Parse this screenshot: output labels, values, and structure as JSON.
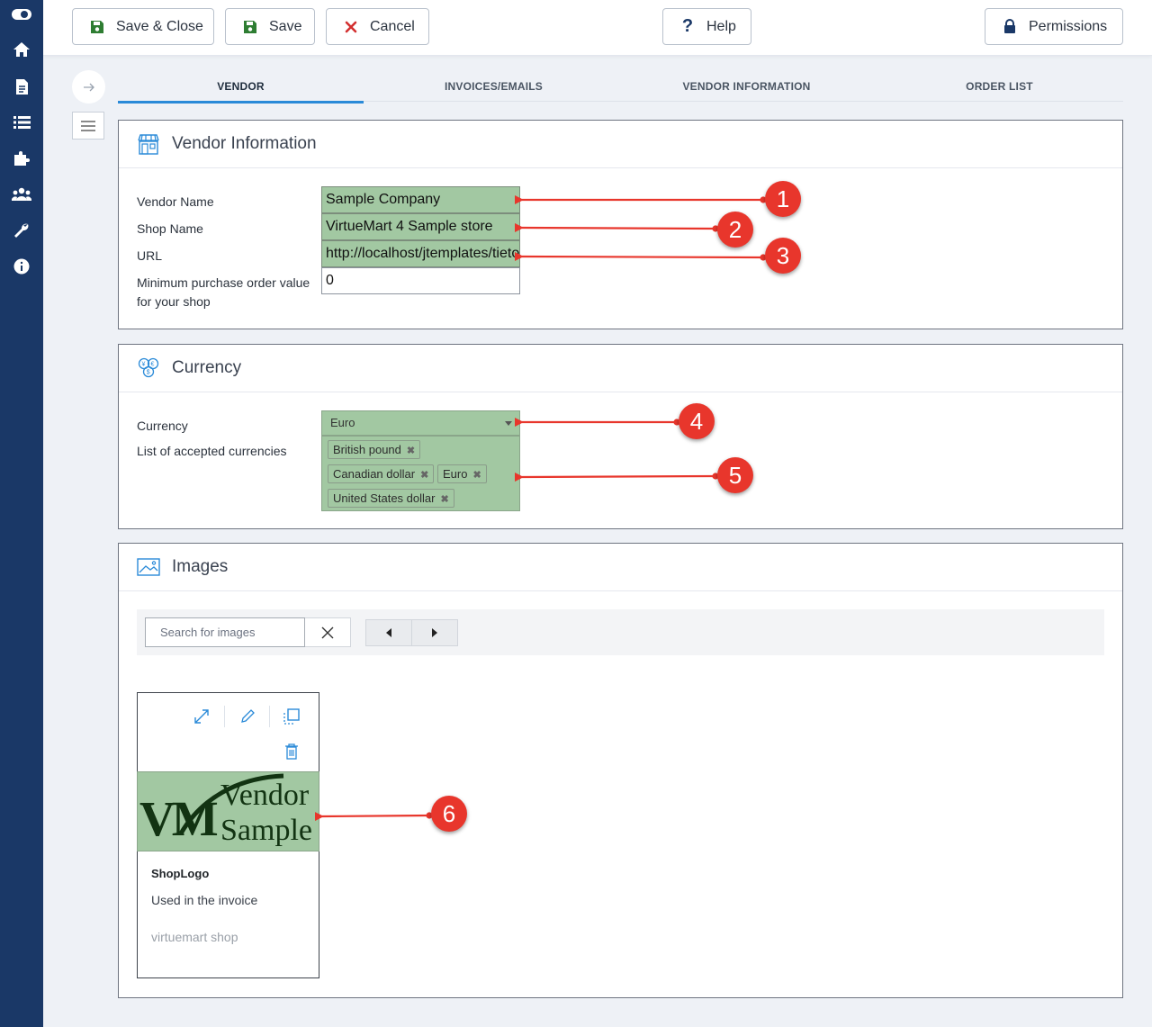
{
  "toolbar": {
    "save_close": "Save & Close",
    "save": "Save",
    "cancel": "Cancel",
    "help": "Help",
    "permissions": "Permissions"
  },
  "tabs": [
    {
      "label": "VENDOR",
      "active": true
    },
    {
      "label": "INVOICES/EMAILS",
      "active": false
    },
    {
      "label": "VENDOR INFORMATION",
      "active": false
    },
    {
      "label": "ORDER LIST",
      "active": false
    }
  ],
  "vendor_panel": {
    "title": "Vendor Information",
    "vendor_name_label": "Vendor Name",
    "vendor_name_value": "Sample Company",
    "shop_name_label": "Shop Name",
    "shop_name_value": "VirtueMart 4 Sample store",
    "url_label": "URL",
    "url_value": "http://localhost/jtemplates/tieto",
    "min_order_label_1": "Minimum purchase order value",
    "min_order_label_2": "for your shop",
    "min_order_value": "0"
  },
  "currency_panel": {
    "title": "Currency",
    "currency_label": "Currency",
    "currency_value": "Euro",
    "accepted_label": "List of accepted currencies",
    "accepted": [
      "British pound",
      "Canadian dollar",
      "Euro",
      "United States dollar"
    ]
  },
  "images_panel": {
    "title": "Images",
    "search_placeholder": "Search for images",
    "card": {
      "logo_mark": "VM",
      "logo_line1": "Vendor",
      "logo_line2": "Sample",
      "title": "ShopLogo",
      "description": "Used in the invoice",
      "meta": "virtuemart shop"
    }
  },
  "callouts": [
    "1",
    "2",
    "3",
    "4",
    "5",
    "6"
  ],
  "colors": {
    "sidebar": "#1a3867",
    "highlight": "#a2c8a2",
    "accent": "#2a8ad8",
    "callout": "#e8362c"
  },
  "icons": {
    "sidebar": [
      "toggle-icon",
      "home-icon",
      "document-icon",
      "list-icon",
      "puzzle-icon",
      "users-icon",
      "wrench-icon",
      "info-icon"
    ]
  }
}
